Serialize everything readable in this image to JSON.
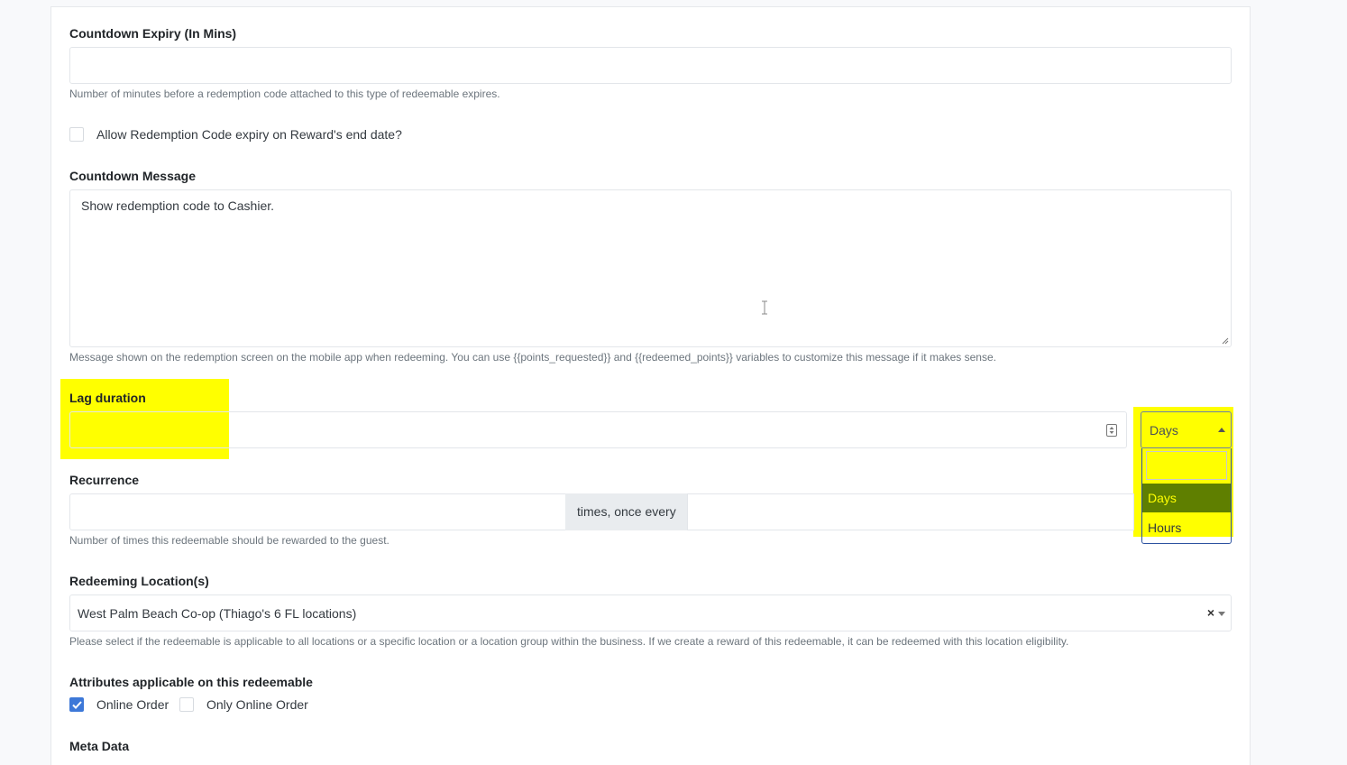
{
  "countdown_expiry": {
    "label": "Countdown Expiry (In Mins)",
    "value": "",
    "help": "Number of minutes before a redemption code attached to this type of redeemable expires."
  },
  "allow_expiry_checkbox": {
    "label": "Allow Redemption Code expiry on Reward's end date?",
    "checked": false
  },
  "countdown_message": {
    "label": "Countdown Message",
    "value": "Show redemption code to Cashier.",
    "help": "Message shown on the redemption screen on the mobile app when redeeming. You can use {{points_requested}} and {{redeemed_points}} variables to customize this message if it makes sense."
  },
  "lag_duration": {
    "label": "Lag duration",
    "value": "",
    "unit_selected": "Days",
    "dropdown": {
      "search_value": "",
      "options": [
        "Days",
        "Hours"
      ],
      "highlighted": "Days"
    }
  },
  "recurrence": {
    "label": "Recurrence",
    "times_value": "",
    "addon": "times, once every",
    "help": "Number of times this redeemable should be rewarded to the guest."
  },
  "redeeming_locations": {
    "label": "Redeeming Location(s)",
    "selected": "West Palm Beach Co-op (Thiago's 6 FL locations)",
    "clear_symbol": "×",
    "help": "Please select if the redeemable is applicable to all locations or a specific location or a location group within the business. If we create a reward of this redeemable, it can be redeemed with this location eligibility."
  },
  "attributes": {
    "label": "Attributes applicable on this redeemable",
    "options": [
      {
        "label": "Online Order",
        "checked": true
      },
      {
        "label": "Only Online Order",
        "checked": false
      }
    ]
  },
  "meta_data": {
    "label": "Meta Data"
  },
  "colors": {
    "highlight": "#ffff00",
    "dropdown_selected_bg": "#5f7f00",
    "checkbox_checked": "#3d78d8",
    "dropdown_border": "#2c52a0"
  },
  "icons": {
    "number_field_icon": "number-stepper-icon",
    "select_arrow_up": "caret-up-icon",
    "select_arrow_down": "caret-down-icon",
    "check": "checkmark-icon"
  }
}
